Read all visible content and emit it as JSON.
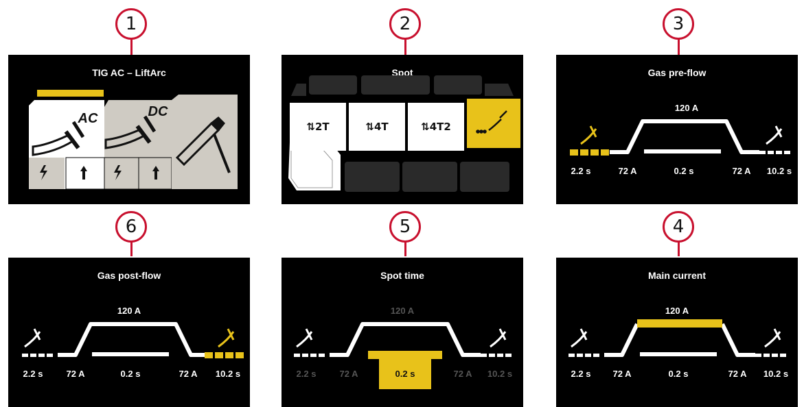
{
  "callouts": [
    "1",
    "2",
    "3",
    "4",
    "5",
    "6"
  ],
  "screen1": {
    "title": "TIG AC – LiftArc",
    "ac_label": "AC",
    "dc_label": "DC"
  },
  "screen2": {
    "title": "Spot",
    "modes": [
      "2T",
      "4T",
      "4T2"
    ],
    "selected": "spot-torch"
  },
  "screen3": {
    "title": "Gas pre-flow",
    "peak": "120 A",
    "labels": [
      "2.2 s",
      "72 A",
      "0.2 s",
      "72 A",
      "10.2 s"
    ],
    "highlight": "pre-flow"
  },
  "screen4": {
    "title": "Main current",
    "peak": "120 A",
    "labels": [
      "2.2 s",
      "72 A",
      "0.2 s",
      "72 A",
      "10.2 s"
    ],
    "highlight": "main-current"
  },
  "screen5": {
    "title": "Spot time",
    "peak": "120 A",
    "labels": [
      "2.2 s",
      "72 A",
      "0.2 s",
      "72 A",
      "10.2 s"
    ],
    "highlight": "spot-time"
  },
  "screen6": {
    "title": "Gas post-flow",
    "peak": "120 A",
    "labels": [
      "2.2 s",
      "72 A",
      "0.2 s",
      "72 A",
      "10.2 s"
    ],
    "highlight": "post-flow"
  },
  "colors": {
    "accent": "#e8c21a",
    "screen_bg": "#000000",
    "callout_ring": "#c8102e",
    "panel_gray": "#cfcbc3"
  }
}
